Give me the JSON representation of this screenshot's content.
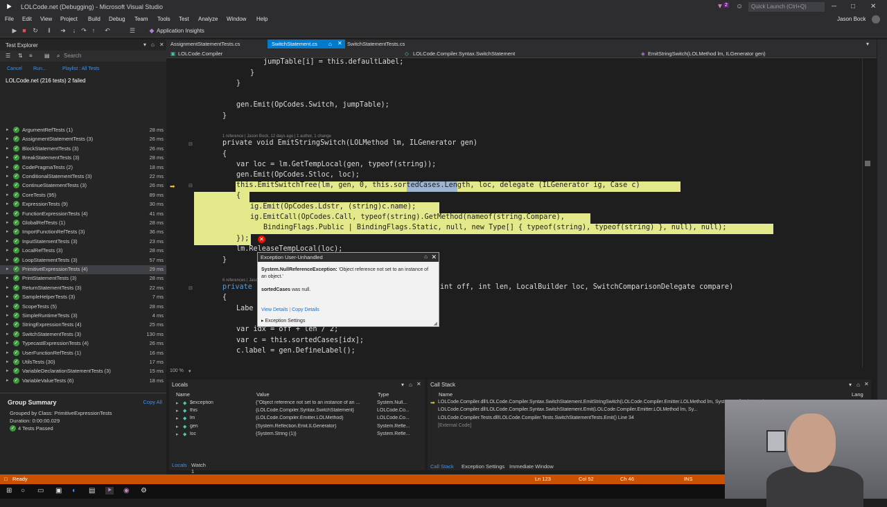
{
  "window": {
    "title": "LOLCode.net (Debugging) - Microsoft Visual Studio",
    "quick_launch": "Quick Launch (Ctrl+Q)",
    "user": "Jason Bock",
    "notification_count": "2"
  },
  "menu": [
    "File",
    "Edit",
    "View",
    "Project",
    "Build",
    "Debug",
    "Team",
    "Tools",
    "Test",
    "Analyze",
    "Window",
    "Help"
  ],
  "toolbar": {
    "app_insights": "Application Insights"
  },
  "test_explorer": {
    "title": "Test Explorer",
    "search_placeholder": "Search",
    "actions": {
      "cancel": "Cancel",
      "run": "Run...",
      "playlist": "Playlist : All Tests"
    },
    "root": "LOLCode.net (216 tests) 2 failed",
    "tests": [
      {
        "name": "ArgumentRefTests (1)",
        "duration": "28 ms"
      },
      {
        "name": "AssignmentStatementTests (3)",
        "duration": "26 ms"
      },
      {
        "name": "BlockStatementTests (3)",
        "duration": "26 ms"
      },
      {
        "name": "BreakStatementTests (3)",
        "duration": "28 ms"
      },
      {
        "name": "CodePragmaTests (2)",
        "duration": "18 ms"
      },
      {
        "name": "ConditionalStatementTests (3)",
        "duration": "22 ms"
      },
      {
        "name": "ContinueStatementTests (3)",
        "duration": "26 ms"
      },
      {
        "name": "CoreTests (95)",
        "duration": "89 ms"
      },
      {
        "name": "ExpressionTests (9)",
        "duration": "30 ms"
      },
      {
        "name": "FunctionExpressionTests (4)",
        "duration": "41 ms"
      },
      {
        "name": "GlobalRefTests (1)",
        "duration": "28 ms"
      },
      {
        "name": "ImportFunctionRefTests (3)",
        "duration": "36 ms"
      },
      {
        "name": "InputStatementTests (3)",
        "duration": "23 ms"
      },
      {
        "name": "LocalRefTests (3)",
        "duration": "28 ms"
      },
      {
        "name": "LoopStatementTests (3)",
        "duration": "57 ms"
      },
      {
        "name": "PrimitiveExpressionTests (4)",
        "duration": "29 ms"
      },
      {
        "name": "PrintStatementTests (3)",
        "duration": "28 ms"
      },
      {
        "name": "ReturnStatementTests (3)",
        "duration": "22 ms"
      },
      {
        "name": "SampleHelperTests (3)",
        "duration": "7 ms"
      },
      {
        "name": "ScopeTests (5)",
        "duration": "28 ms"
      },
      {
        "name": "SimpleRuntimeTests (3)",
        "duration": "4 ms"
      },
      {
        "name": "StringExpressionTests (4)",
        "duration": "25 ms"
      },
      {
        "name": "SwitchStatementTests (3)",
        "duration": "130 ms"
      },
      {
        "name": "TypecastExpressionTests (4)",
        "duration": "26 ms"
      },
      {
        "name": "UserFunctionRefTests (1)",
        "duration": "16 ms"
      },
      {
        "name": "UtilsTests (30)",
        "duration": "17 ms"
      },
      {
        "name": "VariableDeclarationStatementTests (3)",
        "duration": "15 ms"
      },
      {
        "name": "VariableValueTests (6)",
        "duration": "18 ms"
      }
    ],
    "selected_index": 15,
    "group_summary": {
      "title": "Group Summary",
      "copy_all": "Copy All",
      "grouped_by": "Grouped by Class: PrimitiveExpressionTests",
      "duration": "Duration: 0:00:00.029",
      "passed": "4 Tests Passed"
    }
  },
  "editor": {
    "tabs": [
      {
        "label": "AssignmentStatementTests.cs",
        "active": false
      },
      {
        "label": "SwitchStatement.cs",
        "active": true
      },
      {
        "label": "SwitchStatementTests.cs",
        "active": false
      }
    ],
    "nav": {
      "project": "LOLCode.Compiler",
      "class": "LOLCode.Compiler.Syntax.SwitchStatement",
      "member": "EmitStringSwitch(LOLMethod lm, ILGenerator gen)"
    },
    "lens1": "1 reference | Jason Bock, 12 days ago | 1 author, 1 change",
    "lens2": "6 references | Jason",
    "lines": [
      "jumpTable[i] = this.defaultLabel;",
      "}",
      "}",
      "gen.Emit(OpCodes.Switch, jumpTable);",
      "}",
      "private void EmitStringSwitch(LOLMethod lm, ILGenerator gen)",
      "{",
      "var loc = lm.GetTempLocal(gen, typeof(string));",
      "gen.Emit(OpCodes.Stloc, loc);",
      "this.EmitSwitchTree(lm, gen, 0, this.sortedCases.Length, loc, delegate (ILGenerator ig, Case c)",
      "{",
      "ig.Emit(OpCodes.Ldstr, (string)c.name);",
      "ig.EmitCall(OpCodes.Call, typeof(string).GetMethod(nameof(string.Compare),",
      "BindingFlags.Public | BindingFlags.Static, null, new Type[] { typeof(string), typeof(string) }, null), null);",
      "});",
      "lm.ReleaseTempLocal(loc);",
      "}",
      "private",
      "int off, int len, LocalBuilder loc, SwitchComparisonDelegate compare)",
      "{",
      "Labe",
      "var idx = off + len / 2;",
      "var c = this.sortedCases[idx];",
      "c.label = gen.DefineLabel();"
    ],
    "zoom": "100 %"
  },
  "exception_popup": {
    "title": "Exception User-Unhandled",
    "exception_type": "System.NullReferenceException:",
    "message": "'Object reference not set to an instance of an object.'",
    "null_var": "sortedCases",
    "null_text": "was null.",
    "view_details": "View Details",
    "copy_details": "Copy Details",
    "settings": "Exception Settings"
  },
  "locals": {
    "title": "Locals",
    "columns": [
      "Name",
      "Value",
      "Type"
    ],
    "rows": [
      {
        "name": "$exception",
        "value": "{\"Object reference not set to an instance of an ...",
        "type": "System.Null..."
      },
      {
        "name": "this",
        "value": "{LOLCode.Compiler.Syntax.SwitchStatement}",
        "type": "LOLCode.Co..."
      },
      {
        "name": "lm",
        "value": "{LOLCode.Compiler.Emitter.LOLMethod}",
        "type": "LOLCode.Co..."
      },
      {
        "name": "gen",
        "value": "{System.Reflection.Emit.ILGenerator}",
        "type": "System.Refle..."
      },
      {
        "name": "loc",
        "value": "{System.String (1)}",
        "type": "System.Refle..."
      }
    ],
    "tabs": [
      "Locals",
      "Watch 1"
    ]
  },
  "call_stack": {
    "title": "Call Stack",
    "columns": [
      "Name",
      "Lang"
    ],
    "rows": [
      "LOLCode.Compiler.dll!LOLCode.Compiler.Syntax.SwitchStatement.EmitStringSwitch(LOLCode.Compiler.Emitter.LOLMethod lm, System.Reflection.Emit.ILGenerator ge...",
      "LOLCode.Compiler.dll!LOLCode.Compiler.Syntax.SwitchStatement.Emit(LOLCode.Compiler.Emitter.LOLMethod lm, Sy...",
      "LOLCode.Compiler.Tests.dll!LOLCode.Compiler.Tests.SwitchStatementTests.Emit() Line 34",
      "[External Code]"
    ],
    "lang": "C#",
    "tabs": [
      "Call Stack",
      "Exception Settings",
      "Immediate Window"
    ]
  },
  "status": {
    "ready": "Ready",
    "line": "Ln 123",
    "col": "Col 52",
    "ch": "Ch 46",
    "mode": "INS"
  },
  "colors": {
    "accent": "#007acc",
    "status_bar": "#ca5100",
    "highlight": "#e3e88a",
    "pass": "#3c9a3c"
  }
}
